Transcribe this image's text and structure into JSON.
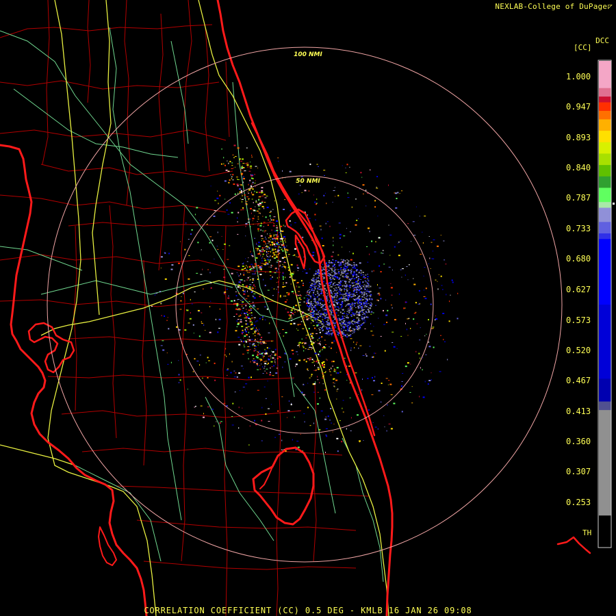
{
  "header": {
    "credit": "NEXLAB-College of DuPage",
    "credit_corner_glyph": "◸"
  },
  "colors": {
    "text": "#ffff55",
    "range_rings": "#f2a6a6",
    "coastline": "#ff1a1a",
    "county_lines": "#b30000",
    "highways": "#e8f040",
    "secondary_roads": "#70d890"
  },
  "range_rings": [
    {
      "label": "100 NMI",
      "radius_nmi": 100
    },
    {
      "label": "50 NMI",
      "radius_nmi": 50
    }
  ],
  "color_scale": {
    "product_label": "DCC",
    "unit_label": "[CC]",
    "threshold_label": "TH",
    "ticks": [
      "1.000",
      "0.947",
      "0.893",
      "0.840",
      "0.787",
      "0.733",
      "0.680",
      "0.627",
      "0.573",
      "0.520",
      "0.467",
      "0.413",
      "0.360",
      "0.307",
      "0.253"
    ],
    "segments": [
      {
        "color": "#f4a6c6",
        "from": 0.98,
        "to": 1.05
      },
      {
        "color": "#e07090",
        "from": 0.965,
        "to": 0.98
      },
      {
        "color": "#cc1030",
        "from": 0.955,
        "to": 0.965
      },
      {
        "color": "#ff3000",
        "from": 0.94,
        "to": 0.955
      },
      {
        "color": "#ff7000",
        "from": 0.925,
        "to": 0.94
      },
      {
        "color": "#ffb000",
        "from": 0.905,
        "to": 0.925
      },
      {
        "color": "#ffe000",
        "from": 0.885,
        "to": 0.905
      },
      {
        "color": "#d8f000",
        "from": 0.865,
        "to": 0.885
      },
      {
        "color": "#a8e000",
        "from": 0.845,
        "to": 0.865
      },
      {
        "color": "#60c000",
        "from": 0.825,
        "to": 0.845
      },
      {
        "color": "#30a030",
        "from": 0.805,
        "to": 0.825
      },
      {
        "color": "#60ff60",
        "from": 0.78,
        "to": 0.805
      },
      {
        "color": "#a8e8a8",
        "from": 0.77,
        "to": 0.78
      },
      {
        "color": "#9090d8",
        "from": 0.745,
        "to": 0.77
      },
      {
        "color": "#6060e0",
        "from": 0.725,
        "to": 0.745
      },
      {
        "color": "#3030e8",
        "from": 0.715,
        "to": 0.725
      },
      {
        "color": "#0000ff",
        "from": 0.6,
        "to": 0.715
      },
      {
        "color": "#0000d8",
        "from": 0.47,
        "to": 0.6
      },
      {
        "color": "#0000b0",
        "from": 0.43,
        "to": 0.47
      },
      {
        "color": "#505090",
        "from": 0.415,
        "to": 0.43
      },
      {
        "color": "#909090",
        "from": 0.23,
        "to": 0.415
      },
      {
        "color": "#000000",
        "from": 0.2,
        "to": 0.23
      }
    ]
  },
  "footer": {
    "product_line": "CORRELATION COEFFICIENT (CC) 0.5 DEG - KMLB 16 JAN 26 09:08"
  }
}
